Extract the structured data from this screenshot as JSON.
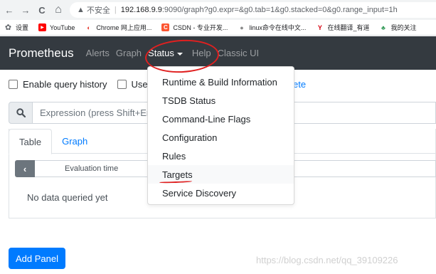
{
  "browser": {
    "back_icon": "←",
    "forward_icon": "→",
    "reload_icon": "C",
    "home_icon": "⌂",
    "warning_icon": "▲",
    "insecure_label": "不安全",
    "separator": "|",
    "url_host": "192.168.9.9",
    "url_rest": ":9090/graph?g0.expr=&g0.tab=1&g0.stacked=0&g0.range_input=1h"
  },
  "bookmarks": [
    {
      "icon": "gear-icon",
      "glyph": "✿",
      "label": "设置"
    },
    {
      "icon": "youtube-icon",
      "glyph": "▶",
      "label": "YouTube"
    },
    {
      "icon": "chrome-icon",
      "glyph": "◐",
      "label": "Chrome 网上应用..."
    },
    {
      "icon": "csdn-icon",
      "glyph": "C",
      "label": "CSDN - 专业开发..."
    },
    {
      "icon": "globe-icon",
      "glyph": "●",
      "label": "linux命令在线中文..."
    },
    {
      "icon": "youdao-icon",
      "glyph": "Y",
      "label": "在线翻译_有道"
    },
    {
      "icon": "leaf-icon",
      "glyph": "♣",
      "label": "我的关注"
    }
  ],
  "navbar": {
    "brand": "Prometheus",
    "links": {
      "alerts": "Alerts",
      "graph": "Graph",
      "status": "Status",
      "help": "Help",
      "classic": "Classic UI"
    }
  },
  "options": {
    "query_history": "Enable query history",
    "partial_use": "Use",
    "partial_tail": "ete"
  },
  "expression": {
    "placeholder": "Expression (press Shift+En"
  },
  "tabs": {
    "table": "Table",
    "graph": "Graph"
  },
  "table": {
    "back_glyph": "‹",
    "eval_time_placeholder": "Evaluation time",
    "empty_text": "No data queried yet"
  },
  "add_panel_label": "Add Panel",
  "watermark": "https://blog.csdn.net/qq_39109226",
  "status_menu": [
    "Runtime & Build Information",
    "TSDB Status",
    "Command-Line Flags",
    "Configuration",
    "Rules",
    "Targets",
    "Service Discovery"
  ],
  "colors": {
    "navbar": "#343a40",
    "accent": "#007bff",
    "annotation": "#e02020"
  }
}
